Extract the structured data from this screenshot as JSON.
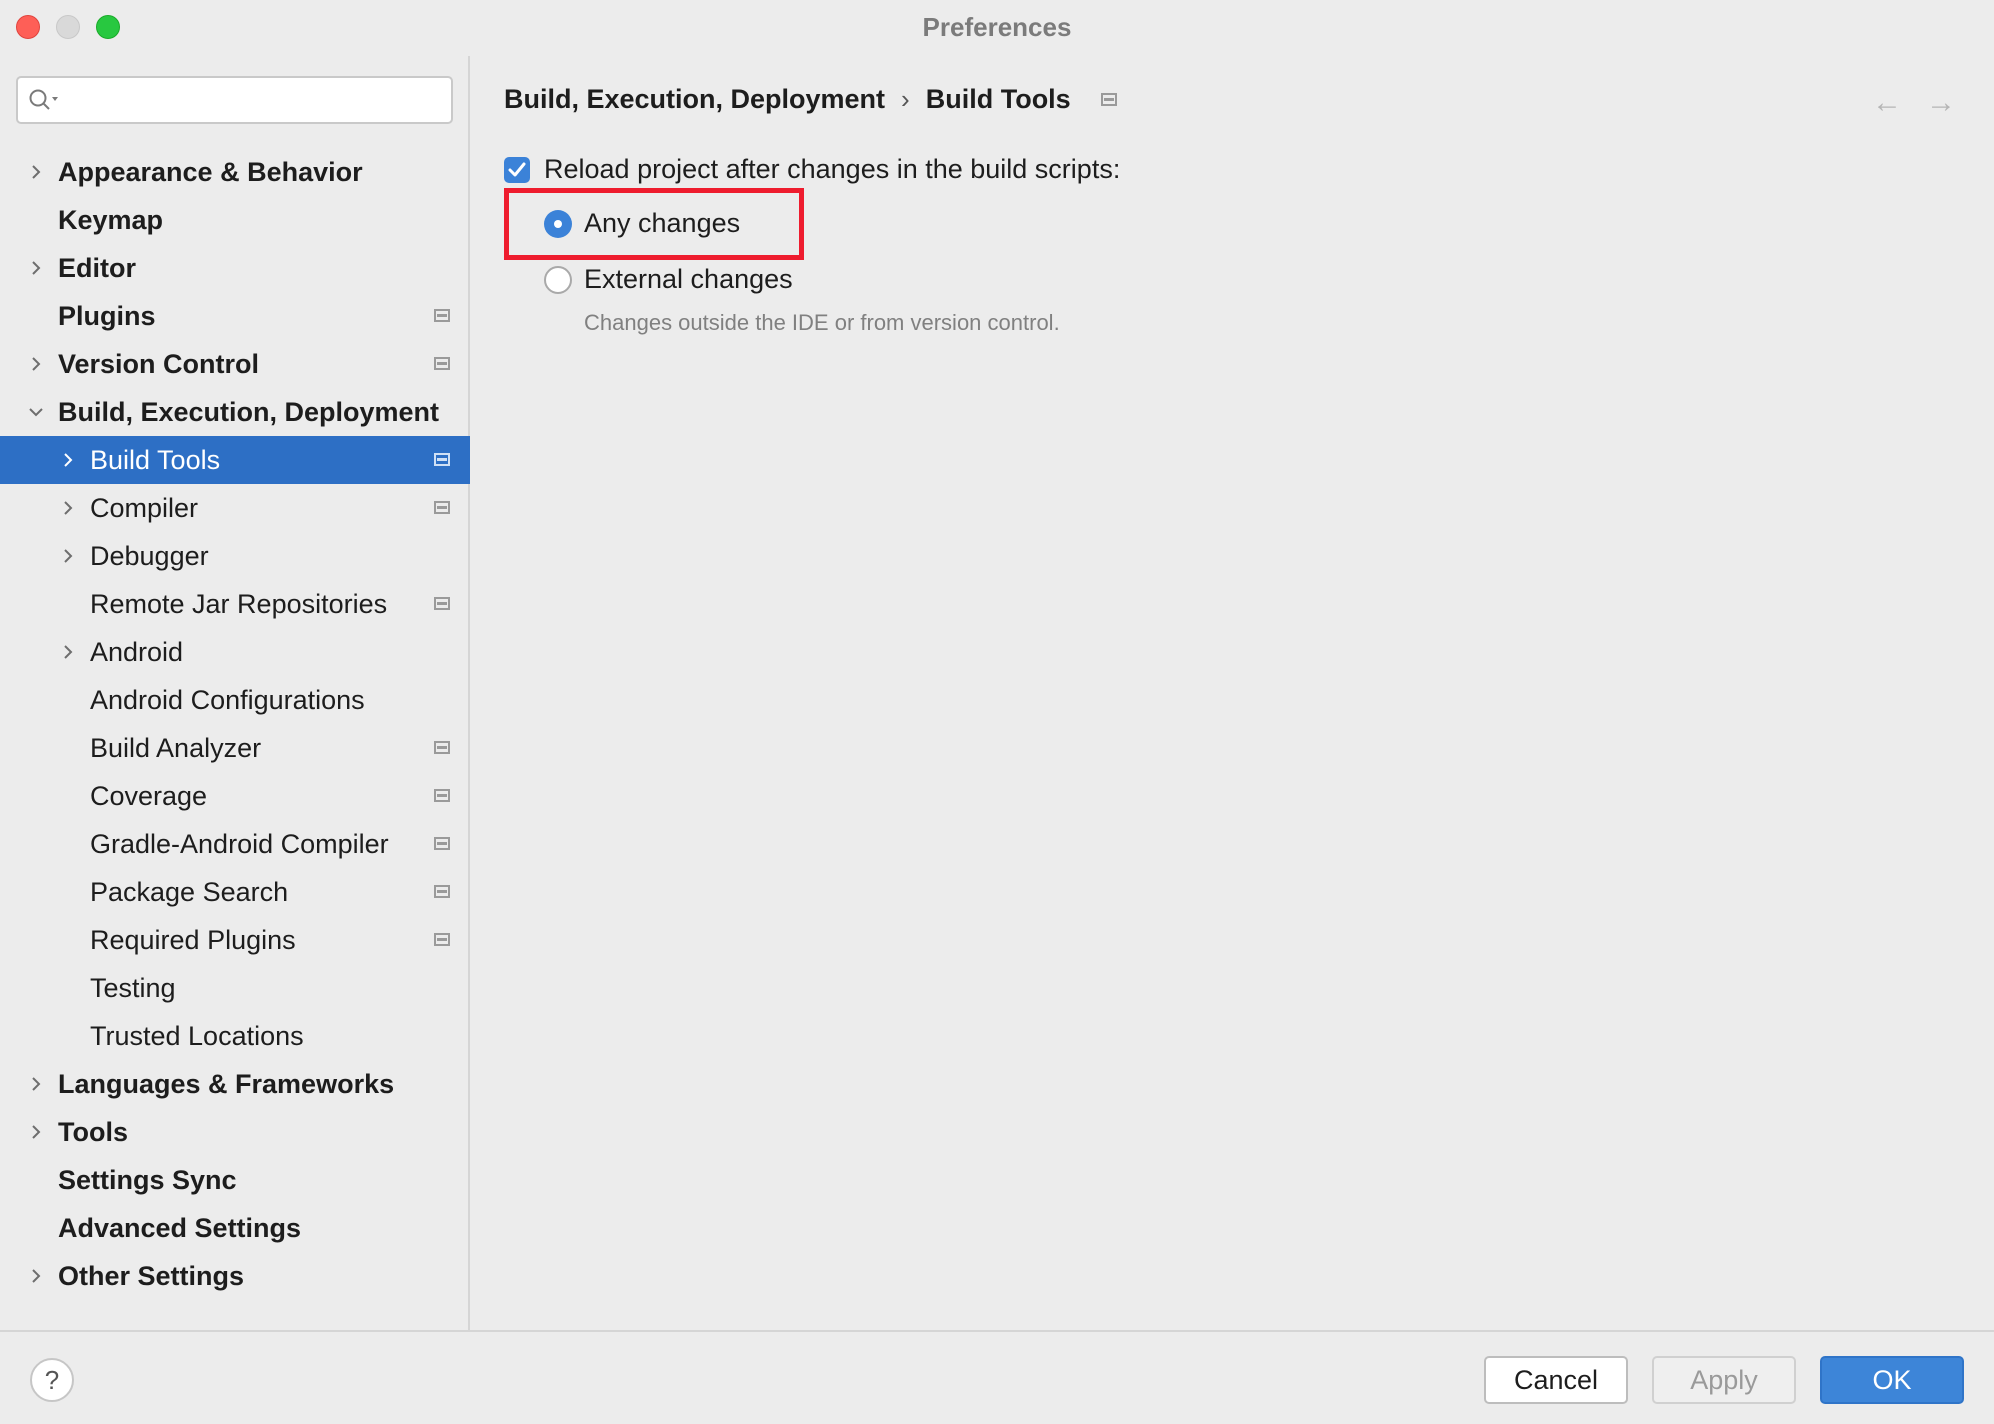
{
  "window": {
    "title": "Preferences"
  },
  "search": {
    "placeholder": "",
    "value": ""
  },
  "sidebar": {
    "items": [
      {
        "label": "Appearance & Behavior",
        "level": 0,
        "expandable": true,
        "expanded": false,
        "project_icon": false
      },
      {
        "label": "Keymap",
        "level": 0,
        "expandable": false,
        "project_icon": false
      },
      {
        "label": "Editor",
        "level": 0,
        "expandable": true,
        "expanded": false,
        "project_icon": false
      },
      {
        "label": "Plugins",
        "level": 0,
        "expandable": false,
        "project_icon": true
      },
      {
        "label": "Version Control",
        "level": 0,
        "expandable": true,
        "expanded": false,
        "project_icon": true
      },
      {
        "label": "Build, Execution, Deployment",
        "level": 0,
        "expandable": true,
        "expanded": true,
        "project_icon": false
      },
      {
        "label": "Build Tools",
        "level": 1,
        "expandable": true,
        "expanded": false,
        "project_icon": true,
        "selected": true
      },
      {
        "label": "Compiler",
        "level": 1,
        "expandable": true,
        "expanded": false,
        "project_icon": true
      },
      {
        "label": "Debugger",
        "level": 1,
        "expandable": true,
        "expanded": false,
        "project_icon": false
      },
      {
        "label": "Remote Jar Repositories",
        "level": 1,
        "expandable": false,
        "project_icon": true
      },
      {
        "label": "Android",
        "level": 1,
        "expandable": true,
        "expanded": false,
        "project_icon": false
      },
      {
        "label": "Android Configurations",
        "level": 1,
        "expandable": false,
        "project_icon": false
      },
      {
        "label": "Build Analyzer",
        "level": 1,
        "expandable": false,
        "project_icon": true
      },
      {
        "label": "Coverage",
        "level": 1,
        "expandable": false,
        "project_icon": true
      },
      {
        "label": "Gradle-Android Compiler",
        "level": 1,
        "expandable": false,
        "project_icon": true
      },
      {
        "label": "Package Search",
        "level": 1,
        "expandable": false,
        "project_icon": true
      },
      {
        "label": "Required Plugins",
        "level": 1,
        "expandable": false,
        "project_icon": true
      },
      {
        "label": "Testing",
        "level": 1,
        "expandable": false,
        "project_icon": false
      },
      {
        "label": "Trusted Locations",
        "level": 1,
        "expandable": false,
        "project_icon": false
      },
      {
        "label": "Languages & Frameworks",
        "level": 0,
        "expandable": true,
        "expanded": false,
        "project_icon": false
      },
      {
        "label": "Tools",
        "level": 0,
        "expandable": true,
        "expanded": false,
        "project_icon": false
      },
      {
        "label": "Settings Sync",
        "level": 0,
        "expandable": false,
        "project_icon": false
      },
      {
        "label": "Advanced Settings",
        "level": 0,
        "expandable": false,
        "project_icon": false
      },
      {
        "label": "Other Settings",
        "level": 0,
        "expandable": true,
        "expanded": false,
        "project_icon": false
      }
    ]
  },
  "breadcrumb": {
    "parent": "Build, Execution, Deployment",
    "separator": "›",
    "current": "Build Tools"
  },
  "nav": {
    "back": "←",
    "forward": "→"
  },
  "settings": {
    "reload_checkbox": {
      "label": "Reload project after changes in the build scripts:",
      "checked": true
    },
    "radio_any": {
      "label": "Any changes",
      "selected": true
    },
    "radio_external": {
      "label": "External changes",
      "selected": false
    },
    "external_hint": "Changes outside the IDE or from version control."
  },
  "footer": {
    "help": "?",
    "cancel": "Cancel",
    "apply": "Apply",
    "ok": "OK"
  },
  "colors": {
    "accent": "#2d6fc5",
    "highlight": "#ee1c2e",
    "button_primary": "#3d85d8"
  },
  "icons": [
    "search-icon",
    "chevron-right-icon",
    "chevron-down-icon",
    "project-settings-icon",
    "back-arrow-icon",
    "forward-arrow-icon",
    "checkmark-icon",
    "help-icon"
  ]
}
